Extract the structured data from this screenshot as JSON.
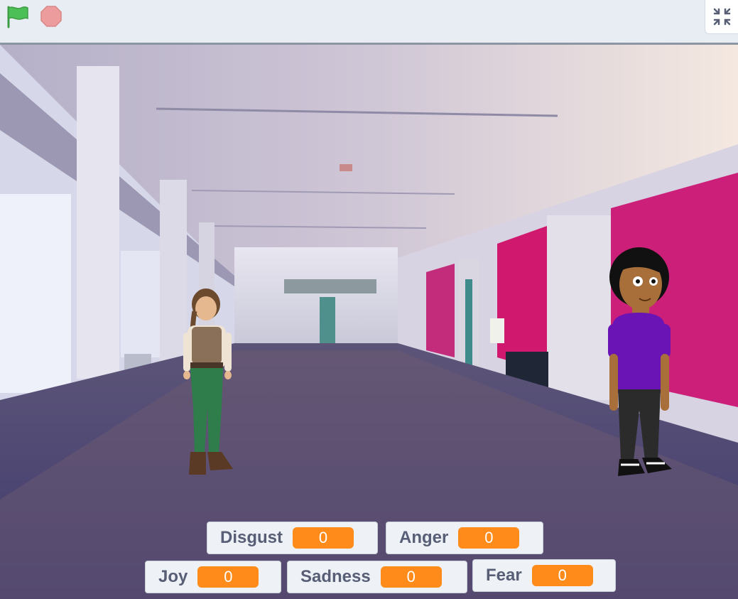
{
  "toolbar": {
    "green_flag_icon": "green-flag-icon",
    "stop_icon": "stop-sign-icon",
    "fullscreen_exit_icon": "fullscreen-exit-icon",
    "colors": {
      "flag": "#4cbf56",
      "stop": "#ec9c9c",
      "accent": "#ff8c1a"
    }
  },
  "stage": {
    "backdrop": "convention-hall-hallway",
    "sprites": [
      "girl-with-braid",
      "girl-purple-shirt"
    ]
  },
  "monitors": [
    {
      "label": "Disgust",
      "value": "0"
    },
    {
      "label": "Anger",
      "value": "0"
    },
    {
      "label": "Joy",
      "value": "0"
    },
    {
      "label": "Sadness",
      "value": "0"
    },
    {
      "label": "Fear",
      "value": "0"
    }
  ]
}
